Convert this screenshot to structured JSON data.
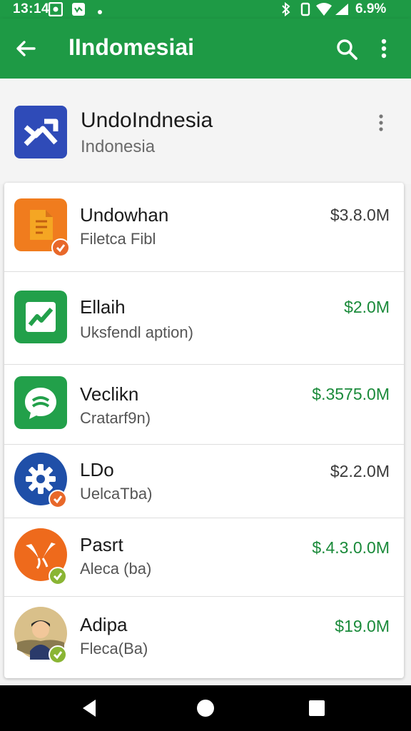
{
  "status_bar": {
    "time": "13:14",
    "battery_text": "6.9%",
    "icons": [
      "photo-icon",
      "messenger-icon",
      "dot-icon",
      "bluetooth-icon",
      "vibrate-icon",
      "wifi-icon",
      "signal-icon"
    ]
  },
  "app_bar": {
    "title": "IIndomesiai",
    "icons": [
      "back-arrow-icon",
      "search-icon",
      "more-vert-icon"
    ]
  },
  "header": {
    "name": "UndoIndnesia",
    "subtitle": "Indonesia",
    "logo_icon": "trend-chart-logo-icon"
  },
  "items": [
    {
      "title": "Undowhan",
      "desc": "Filetca Fibl",
      "amount": "$3.8.0M",
      "amount_color": "dark",
      "icon": "document-app-icon",
      "icon_bg": "#f07c1e",
      "badge": "check-badge-icon",
      "badge_color": "#e8682a"
    },
    {
      "title": "Ellaih",
      "desc": "Uksfendl aption)",
      "amount": "$2.0M",
      "amount_color": "green",
      "icon": "chart-trend-app-icon",
      "icon_bg": "#22a04a",
      "badge": null,
      "badge_color": null
    },
    {
      "title": "Veclikn",
      "desc": "Cratarf9n)",
      "amount": "$.3575.0M",
      "amount_color": "green",
      "icon": "chat-bubble-app-icon",
      "icon_bg": "#22a04a",
      "badge": null,
      "badge_color": null
    },
    {
      "title": "LDo",
      "desc": "UelcaTba)",
      "amount": "$2.2.0M",
      "amount_color": "dark",
      "icon": "gear-app-icon",
      "icon_bg": "#1f4fa8",
      "badge": "check-badge-icon",
      "badge_color": "#e8682a"
    },
    {
      "title": "Pasrt",
      "desc": "Aleca (ba)",
      "amount": "$.4.3.0.0M",
      "amount_color": "green",
      "icon": "bird-app-icon",
      "icon_bg": "#ee6a1c",
      "badge": "check-badge-icon",
      "badge_color": "#8ab534"
    },
    {
      "title": "Adipa",
      "desc": "Fleca(Ba)",
      "amount": "$19.0M",
      "amount_color": "green",
      "icon": "person-avatar-icon",
      "icon_bg": "#d9c08a",
      "badge": "check-badge-icon",
      "badge_color": "#8ab534"
    }
  ],
  "nav_bar": {
    "icons": [
      "back-triangle-icon",
      "home-circle-icon",
      "recents-square-icon"
    ]
  }
}
